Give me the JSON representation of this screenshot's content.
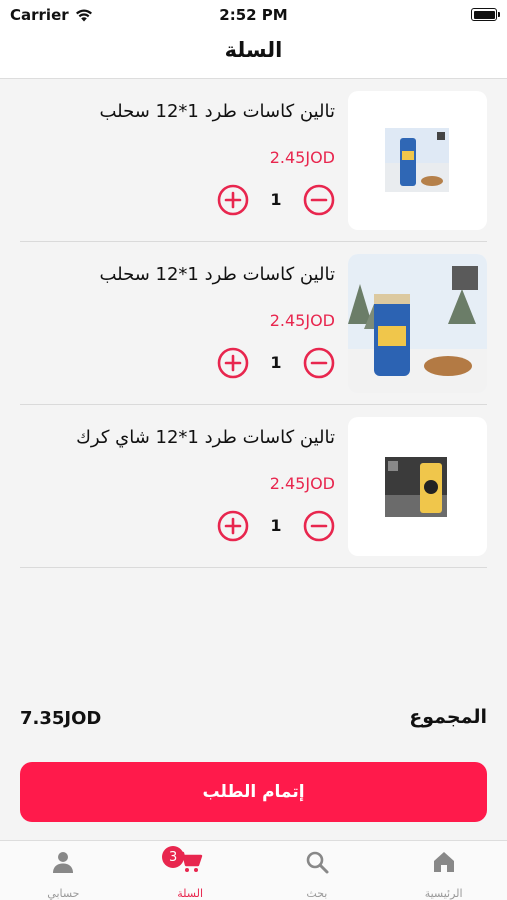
{
  "status_bar": {
    "carrier": "Carrier",
    "time": "2:52 PM"
  },
  "header": {
    "title": "السلة"
  },
  "cart": {
    "items": [
      {
        "name": "تالين كاسات طرد 1*12 سحلب",
        "price": "2.45JOD",
        "quantity": "1",
        "image": "small-product-image"
      },
      {
        "name": "تالين كاسات طرد 1*12 سحلب",
        "price": "2.45JOD",
        "quantity": "1",
        "image": "large-product-image"
      },
      {
        "name": "تالين كاسات طرد 1*12 شاي كرك",
        "price": "2.45JOD",
        "quantity": "1",
        "image": "small-product-image"
      }
    ]
  },
  "summary": {
    "total_label": "المجموع",
    "total_value": "7.35JOD"
  },
  "checkout": {
    "label": "إتمام الطلب"
  },
  "tab_bar": {
    "tabs": [
      {
        "label": "الرئيسية",
        "icon": "home-icon"
      },
      {
        "label": "بحث",
        "icon": "search-icon"
      },
      {
        "label": "السلة",
        "icon": "cart-icon",
        "badge": "3",
        "active": true
      },
      {
        "label": "حسابي",
        "icon": "person-icon"
      }
    ]
  },
  "colors": {
    "accent": "#e8264e",
    "button": "#ff1a4b",
    "background": "#f4f4f4"
  }
}
